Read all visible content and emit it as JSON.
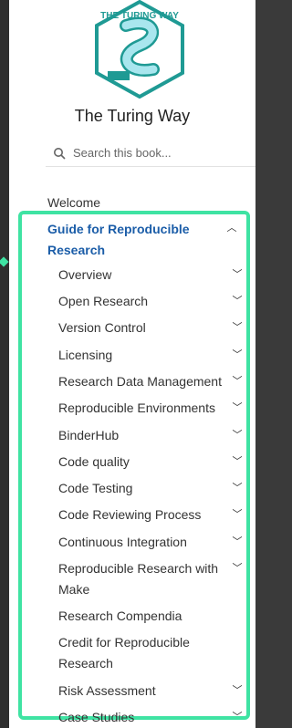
{
  "book": {
    "title": "The Turing Way",
    "logo_text": "THE TURING WAY"
  },
  "search": {
    "placeholder": "Search this book..."
  },
  "nav": {
    "welcome": "Welcome",
    "section": "Guide for Reproducible Research",
    "items": [
      {
        "label": "Overview",
        "chevron": true
      },
      {
        "label": "Open Research",
        "chevron": true
      },
      {
        "label": "Version Control",
        "chevron": true
      },
      {
        "label": "Licensing",
        "chevron": true
      },
      {
        "label": "Research Data Management",
        "chevron": true
      },
      {
        "label": "Reproducible Environments",
        "chevron": true
      },
      {
        "label": "BinderHub",
        "chevron": true
      },
      {
        "label": "Code quality",
        "chevron": true
      },
      {
        "label": "Code Testing",
        "chevron": true
      },
      {
        "label": "Code Reviewing Process",
        "chevron": true
      },
      {
        "label": "Continuous Integration",
        "chevron": true
      },
      {
        "label": "Reproducible Research with Make",
        "chevron": true
      },
      {
        "label": "Research Compendia",
        "chevron": false
      },
      {
        "label": "Credit for Reproducible Research",
        "chevron": false
      },
      {
        "label": "Risk Assessment",
        "chevron": true
      },
      {
        "label": "Case Studies",
        "chevron": true
      }
    ]
  },
  "colors": {
    "accent": "#3fe3a3",
    "link": "#1b5da8",
    "logo": "#1f9a94"
  }
}
